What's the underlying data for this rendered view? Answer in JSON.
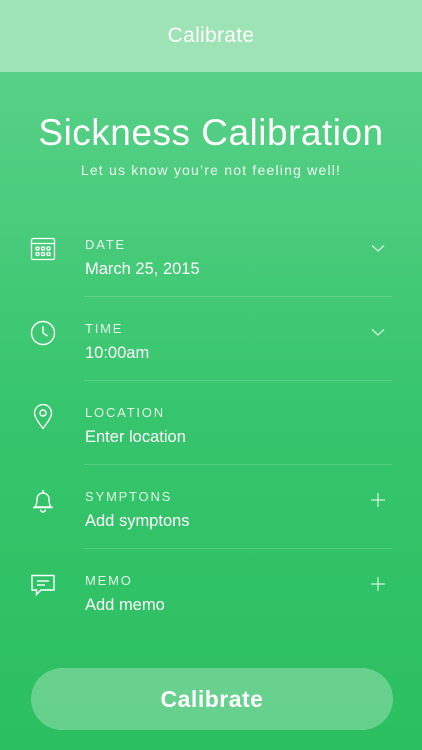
{
  "navbar": {
    "title": "Calibrate"
  },
  "hero": {
    "title": "Sickness Calibration",
    "subtitle": "Let us know you’re not feeling well!"
  },
  "fields": [
    {
      "label": "DATE",
      "value": "March 25, 2015",
      "icon": "calendar-icon",
      "action": "chevron-down-icon"
    },
    {
      "label": "TIME",
      "value": "10:00am",
      "icon": "clock-icon",
      "action": "chevron-down-icon"
    },
    {
      "label": "LOCATION",
      "value": "Enter location",
      "icon": "location-pin-icon",
      "action": ""
    },
    {
      "label": "SYMPTONS",
      "value": "Add symptons",
      "icon": "bell-icon",
      "action": "plus-icon"
    },
    {
      "label": "MEMO",
      "value": "Add memo",
      "icon": "chat-icon",
      "action": "plus-icon"
    }
  ],
  "button": {
    "label": "Calibrate"
  },
  "colors": {
    "accent": "#36c56c",
    "navbar": "#9ee3b6"
  }
}
